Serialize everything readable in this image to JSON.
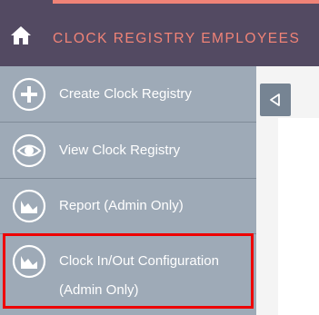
{
  "header": {
    "title": "CLOCK REGISTRY EMPLOYEES",
    "home_icon": "home-icon",
    "accent_color": "#f08377",
    "background_color": "#534a62"
  },
  "menu": {
    "background_color": "#9eaab7",
    "items": [
      {
        "label": "Create Clock Registry",
        "icon": "plus-circle-icon"
      },
      {
        "label": "View Clock Registry",
        "icon": "eye-icon"
      },
      {
        "label": "Report (Admin Only)",
        "icon": "chart-icon"
      },
      {
        "label_line1": "Clock In/Out Configuration",
        "label_line2": "(Admin Only)",
        "icon": "chart-icon",
        "highlighted": true
      }
    ]
  },
  "collapse_button": {
    "icon": "triangle-left-icon"
  },
  "highlight_color": "#ee0000"
}
